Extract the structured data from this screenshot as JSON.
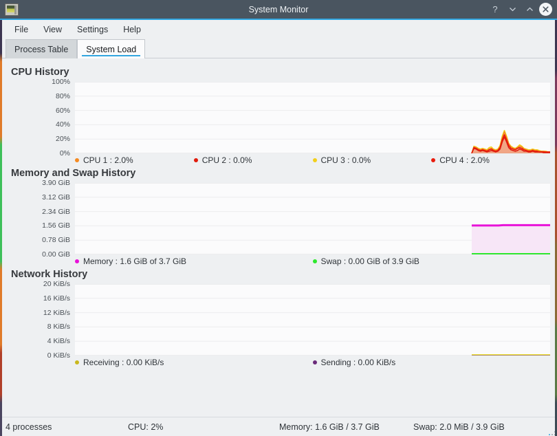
{
  "window": {
    "title": "System Monitor",
    "icon": "monitor-graph-icon",
    "buttons": {
      "help": "?",
      "minimize": "∨",
      "maximize": "∧",
      "close": "✕"
    }
  },
  "menubar": {
    "items": [
      {
        "label": "File"
      },
      {
        "label": "View"
      },
      {
        "label": "Settings"
      },
      {
        "label": "Help"
      }
    ]
  },
  "tabs": [
    {
      "label": "Process Table",
      "active": false
    },
    {
      "label": "System Load",
      "active": true
    }
  ],
  "sections": {
    "cpu": {
      "title": "CPU History"
    },
    "memory": {
      "title": "Memory and Swap History"
    },
    "network": {
      "title": "Network History"
    }
  },
  "statusbar": {
    "processes": "4 processes",
    "cpu": "CPU: 2%",
    "memory": "Memory: 1.6 GiB / 3.7 GiB",
    "swap": "Swap: 2.0 MiB / 3.9 GiB"
  },
  "colors": {
    "accent": "#31a6e0",
    "titlebar": "#4a5560",
    "cpu1": "#f58a21",
    "cpu2": "#e01b0c",
    "cpu3": "#f2cf1b",
    "cpu4": "#e81c0d",
    "memory": "#e812d8",
    "swap": "#2de82d",
    "receiving": "#c9b81e",
    "sending": "#6a2a7a",
    "plot_bg": "#fbfbfc",
    "grid": "#ececee"
  },
  "chart_data": [
    {
      "type": "line",
      "title": "CPU History",
      "xlabel": "",
      "ylabel": "",
      "ylim": [
        0,
        100
      ],
      "yticks": [
        "0%",
        "20%",
        "40%",
        "60%",
        "80%",
        "100%"
      ],
      "grid": true,
      "legend_position": "bottom",
      "series": [
        {
          "name": "CPU 1",
          "legend": "CPU 1 : 2.0%",
          "color": "#f58a21",
          "value": 2.0,
          "values": [
            0,
            0,
            0,
            0,
            0,
            0,
            0,
            0,
            0,
            0,
            0,
            0,
            0,
            0,
            0,
            0,
            0,
            0,
            0,
            0,
            0,
            0,
            0,
            0,
            0,
            0,
            0,
            0,
            0,
            0,
            0,
            0,
            0,
            0,
            0,
            0,
            0,
            0,
            0,
            0,
            0,
            0,
            0,
            0,
            0,
            0,
            0,
            0,
            0,
            0,
            0,
            0,
            0,
            0,
            0,
            0,
            0,
            0,
            0,
            0,
            0,
            0,
            0,
            0,
            0,
            0,
            0,
            0,
            0,
            0,
            0,
            0,
            0,
            0,
            0,
            0,
            0,
            0,
            0,
            0,
            9,
            8,
            6,
            5,
            6,
            5,
            4,
            6,
            7,
            5,
            4,
            5,
            9,
            21,
            30,
            22,
            13,
            9,
            7,
            6,
            8,
            10,
            9,
            6,
            5,
            4,
            4,
            5,
            4,
            4,
            3,
            3,
            3,
            2,
            2,
            2
          ]
        },
        {
          "name": "CPU 2",
          "legend": "CPU 2 : 0.0%",
          "color": "#e01b0c",
          "value": 0.0,
          "values": [
            0,
            0,
            0,
            0,
            0,
            0,
            0,
            0,
            0,
            0,
            0,
            0,
            0,
            0,
            0,
            0,
            0,
            0,
            0,
            0,
            0,
            0,
            0,
            0,
            0,
            0,
            0,
            0,
            0,
            0,
            0,
            0,
            0,
            0,
            0,
            0,
            0,
            0,
            0,
            0,
            0,
            0,
            0,
            0,
            0,
            0,
            0,
            0,
            0,
            0,
            0,
            0,
            0,
            0,
            0,
            0,
            0,
            0,
            0,
            0,
            0,
            0,
            0,
            0,
            0,
            0,
            0,
            0,
            0,
            0,
            0,
            0,
            0,
            0,
            0,
            0,
            0,
            0,
            0,
            0,
            7,
            6,
            4,
            3,
            4,
            3,
            2,
            3,
            4,
            3,
            2,
            3,
            6,
            16,
            23,
            16,
            8,
            5,
            4,
            3,
            4,
            6,
            5,
            3,
            3,
            2,
            2,
            3,
            2,
            2,
            2,
            2,
            1,
            1,
            1,
            1
          ]
        },
        {
          "name": "CPU 3",
          "legend": "CPU 3 : 0.0%",
          "color": "#f2cf1b",
          "value": 0.0,
          "values": [
            0,
            0,
            0,
            0,
            0,
            0,
            0,
            0,
            0,
            0,
            0,
            0,
            0,
            0,
            0,
            0,
            0,
            0,
            0,
            0,
            0,
            0,
            0,
            0,
            0,
            0,
            0,
            0,
            0,
            0,
            0,
            0,
            0,
            0,
            0,
            0,
            0,
            0,
            0,
            0,
            0,
            0,
            0,
            0,
            0,
            0,
            0,
            0,
            0,
            0,
            0,
            0,
            0,
            0,
            0,
            0,
            0,
            0,
            0,
            0,
            0,
            0,
            0,
            0,
            0,
            0,
            0,
            0,
            0,
            0,
            0,
            0,
            0,
            0,
            0,
            0,
            0,
            0,
            0,
            0,
            10,
            9,
            7,
            6,
            7,
            6,
            5,
            8,
            9,
            6,
            5,
            6,
            11,
            24,
            32,
            24,
            14,
            10,
            8,
            7,
            9,
            12,
            10,
            7,
            6,
            5,
            5,
            6,
            5,
            5,
            4,
            3,
            3,
            3,
            2,
            2
          ]
        },
        {
          "name": "CPU 4",
          "legend": "CPU 4 : 2.0%",
          "color": "#e81c0d",
          "value": 2.0,
          "values": [
            0,
            0,
            0,
            0,
            0,
            0,
            0,
            0,
            0,
            0,
            0,
            0,
            0,
            0,
            0,
            0,
            0,
            0,
            0,
            0,
            0,
            0,
            0,
            0,
            0,
            0,
            0,
            0,
            0,
            0,
            0,
            0,
            0,
            0,
            0,
            0,
            0,
            0,
            0,
            0,
            0,
            0,
            0,
            0,
            0,
            0,
            0,
            0,
            0,
            0,
            0,
            0,
            0,
            0,
            0,
            0,
            0,
            0,
            0,
            0,
            0,
            0,
            0,
            0,
            0,
            0,
            0,
            0,
            0,
            0,
            0,
            0,
            0,
            0,
            0,
            0,
            0,
            0,
            0,
            0,
            8,
            7,
            5,
            4,
            5,
            4,
            3,
            5,
            6,
            4,
            3,
            4,
            8,
            19,
            26,
            19,
            11,
            7,
            6,
            5,
            7,
            8,
            7,
            5,
            4,
            3,
            3,
            4,
            3,
            3,
            2,
            2,
            2,
            2,
            2,
            2
          ]
        }
      ]
    },
    {
      "type": "area",
      "title": "Memory and Swap History",
      "xlabel": "",
      "ylabel": "",
      "ylim": [
        0,
        3.9
      ],
      "yticks": [
        "0.00 GiB",
        "0.78 GiB",
        "1.56 GiB",
        "2.34 GiB",
        "3.12 GiB",
        "3.90 GiB"
      ],
      "grid": true,
      "legend_position": "bottom",
      "series": [
        {
          "name": "Memory",
          "legend": "Memory : 1.6 GiB of 3.7 GiB",
          "color": "#e812d8",
          "fill": "#f7e6f7",
          "value": 1.6,
          "unit": "GiB",
          "values": [
            1.58,
            1.58,
            1.58,
            1.58,
            1.58,
            1.58,
            1.58,
            1.58,
            1.58,
            1.58,
            1.58,
            1.58,
            1.58,
            1.59,
            1.6,
            1.6,
            1.6,
            1.6,
            1.6,
            1.6,
            1.6,
            1.6,
            1.6,
            1.6,
            1.6,
            1.6,
            1.6,
            1.6,
            1.6,
            1.6,
            1.6,
            1.6,
            1.6,
            1.6,
            1.6,
            1.6
          ]
        },
        {
          "name": "Swap",
          "legend": "Swap : 0.00 GiB of 3.9 GiB",
          "color": "#2de82d",
          "value": 0.0,
          "unit": "GiB",
          "values": [
            0,
            0,
            0,
            0,
            0,
            0,
            0,
            0,
            0,
            0,
            0,
            0,
            0,
            0,
            0,
            0,
            0,
            0,
            0,
            0,
            0,
            0,
            0,
            0,
            0,
            0,
            0,
            0,
            0,
            0,
            0,
            0,
            0,
            0,
            0,
            0
          ]
        }
      ]
    },
    {
      "type": "line",
      "title": "Network History",
      "xlabel": "",
      "ylabel": "",
      "ylim": [
        0,
        20
      ],
      "yticks": [
        "0 KiB/s",
        "4 KiB/s",
        "8 KiB/s",
        "12 KiB/s",
        "16 KiB/s",
        "20 KiB/s"
      ],
      "grid": true,
      "legend_position": "bottom",
      "series": [
        {
          "name": "Receiving",
          "legend": "Receiving : 0.00 KiB/s",
          "color": "#c9b81e",
          "line_color": "#f2e83c",
          "value": 0.0,
          "unit": "KiB/s",
          "values": [
            0,
            0,
            0,
            0,
            0,
            0,
            0,
            0,
            0,
            0,
            0,
            0,
            0,
            0,
            0,
            0,
            0,
            0,
            0,
            0,
            0,
            0,
            0,
            0,
            0,
            0,
            0,
            0,
            0,
            0,
            0,
            0,
            0,
            0,
            0,
            0
          ]
        },
        {
          "name": "Sending",
          "legend": "Sending : 0.00 KiB/s",
          "color": "#6a2a7a",
          "line_color": "#6a2a7a",
          "value": 0.0,
          "unit": "KiB/s",
          "values": [
            0,
            0,
            0,
            0,
            0,
            0,
            0,
            0,
            0,
            0,
            0,
            0,
            0,
            0,
            0,
            0,
            0,
            0,
            0,
            0,
            0,
            0,
            0,
            0,
            0,
            0,
            0,
            0,
            0,
            0,
            0,
            0,
            0,
            0,
            0,
            0
          ]
        }
      ]
    }
  ]
}
